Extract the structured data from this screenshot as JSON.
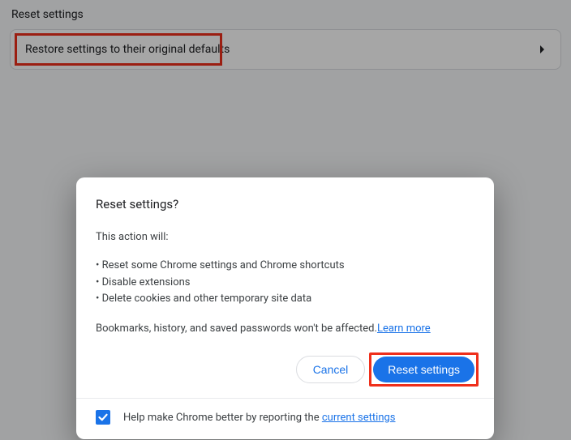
{
  "section": {
    "title": "Reset settings",
    "row_label": "Restore settings to their original defaults"
  },
  "dialog": {
    "title": "Reset settings?",
    "intro": "This action will:",
    "bullets": [
      "Reset some Chrome settings and Chrome shortcuts",
      "Disable extensions",
      "Delete cookies and other temporary site data"
    ],
    "note_prefix": "Bookmarks, history, and saved passwords won't be affected.",
    "learn_more": "Learn more",
    "cancel": "Cancel",
    "confirm": "Reset settings",
    "footer_prefix": "Help make Chrome better by reporting the ",
    "footer_link": "current settings",
    "report_checked": true
  },
  "colors": {
    "accent": "#1a73e8",
    "highlight": "#ef2f1b"
  }
}
